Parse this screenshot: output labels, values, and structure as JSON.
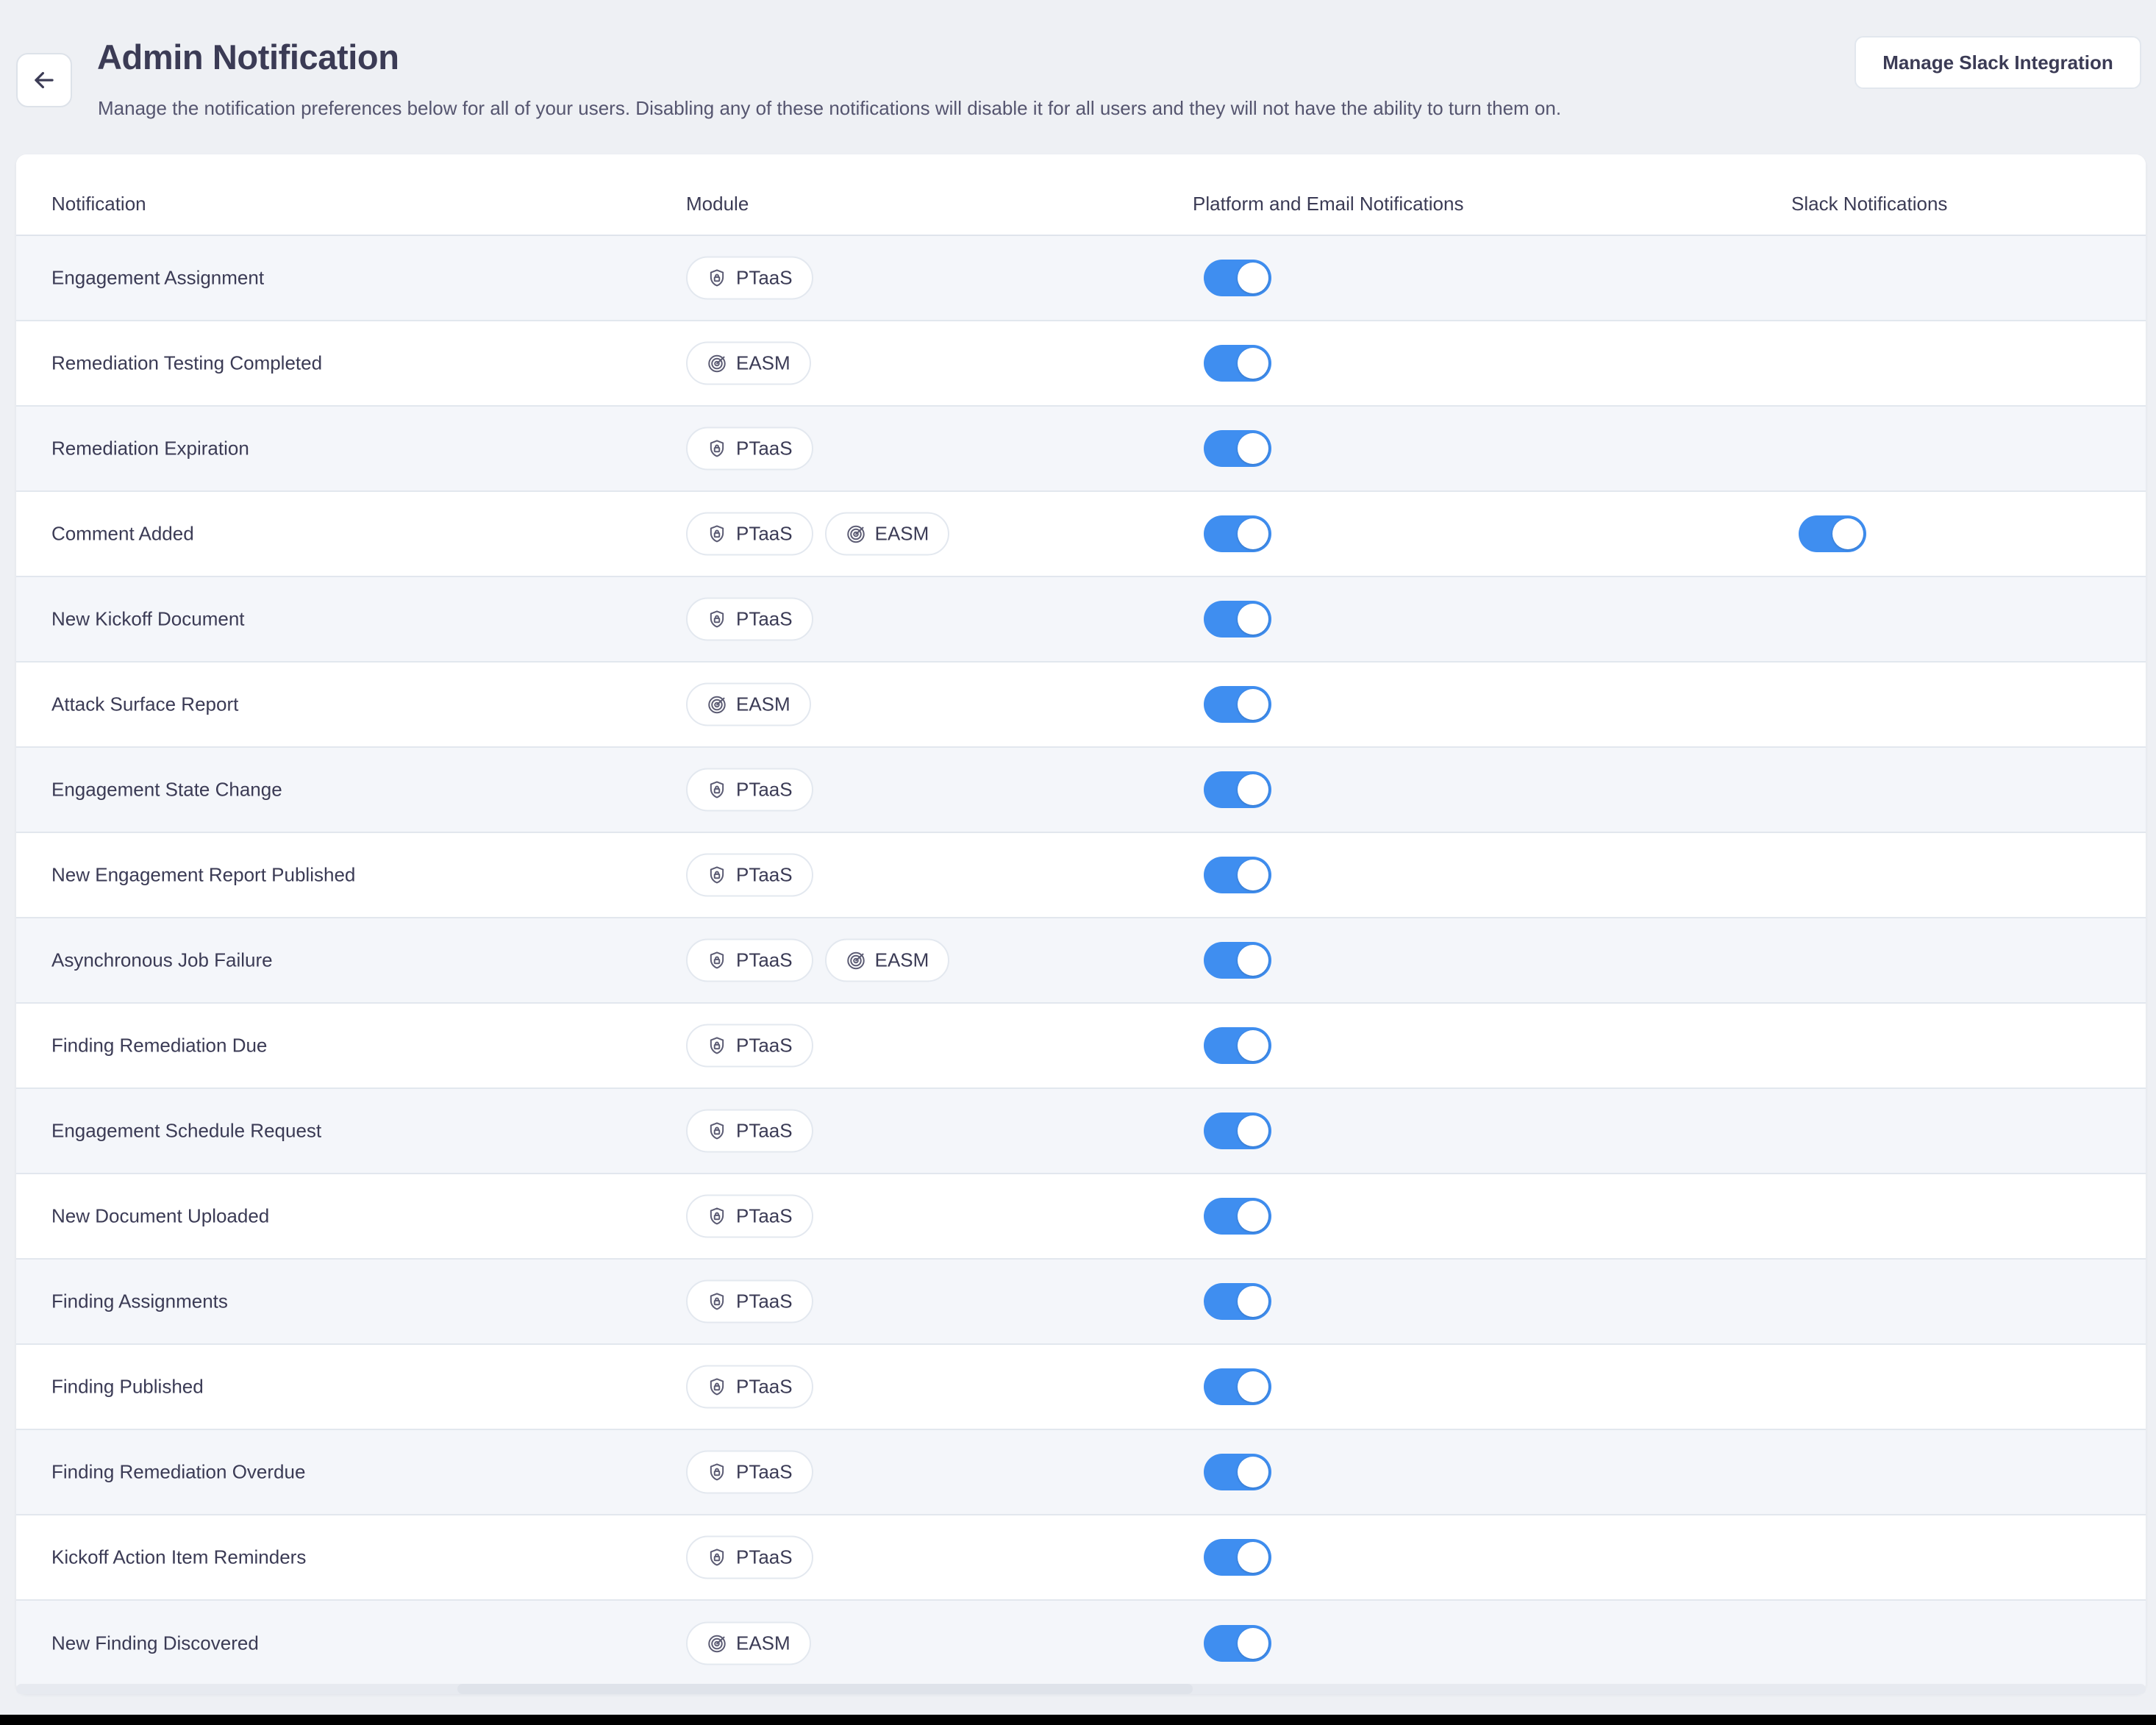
{
  "header": {
    "back_icon": "arrow-left-icon",
    "title": "Admin Notification",
    "subtitle": "Manage the notification preferences below for all of your users. Disabling any of these notifications will disable it for all users and they will not have the ability to turn them on.",
    "manage_slack_label": "Manage Slack Integration"
  },
  "table": {
    "columns": {
      "notification": "Notification",
      "module": "Module",
      "platform": "Platform and Email Notifications",
      "slack": "Slack Notifications"
    },
    "modules": {
      "ptaas": {
        "label": "PTaaS",
        "icon": "shield-lock-icon"
      },
      "easm": {
        "label": "EASM",
        "icon": "radar-target-icon"
      }
    },
    "rows": [
      {
        "notification": "Engagement Assignment",
        "modules": [
          "PTaaS"
        ],
        "platform_on": true,
        "slack_on": null
      },
      {
        "notification": "Remediation Testing Completed",
        "modules": [
          "EASM"
        ],
        "platform_on": true,
        "slack_on": null
      },
      {
        "notification": "Remediation Expiration",
        "modules": [
          "PTaaS"
        ],
        "platform_on": true,
        "slack_on": null
      },
      {
        "notification": "Comment Added",
        "modules": [
          "PTaaS",
          "EASM"
        ],
        "platform_on": true,
        "slack_on": true
      },
      {
        "notification": "New Kickoff Document",
        "modules": [
          "PTaaS"
        ],
        "platform_on": true,
        "slack_on": null
      },
      {
        "notification": "Attack Surface Report",
        "modules": [
          "EASM"
        ],
        "platform_on": true,
        "slack_on": null
      },
      {
        "notification": "Engagement State Change",
        "modules": [
          "PTaaS"
        ],
        "platform_on": true,
        "slack_on": null
      },
      {
        "notification": "New Engagement Report Published",
        "modules": [
          "PTaaS"
        ],
        "platform_on": true,
        "slack_on": null
      },
      {
        "notification": "Asynchronous Job Failure",
        "modules": [
          "PTaaS",
          "EASM"
        ],
        "platform_on": true,
        "slack_on": null
      },
      {
        "notification": "Finding Remediation Due",
        "modules": [
          "PTaaS"
        ],
        "platform_on": true,
        "slack_on": null
      },
      {
        "notification": "Engagement Schedule Request",
        "modules": [
          "PTaaS"
        ],
        "platform_on": true,
        "slack_on": null
      },
      {
        "notification": "New Document Uploaded",
        "modules": [
          "PTaaS"
        ],
        "platform_on": true,
        "slack_on": null
      },
      {
        "notification": "Finding Assignments",
        "modules": [
          "PTaaS"
        ],
        "platform_on": true,
        "slack_on": null
      },
      {
        "notification": "Finding Published",
        "modules": [
          "PTaaS"
        ],
        "platform_on": true,
        "slack_on": null
      },
      {
        "notification": "Finding Remediation Overdue",
        "modules": [
          "PTaaS"
        ],
        "platform_on": true,
        "slack_on": null
      },
      {
        "notification": "Kickoff Action Item Reminders",
        "modules": [
          "PTaaS"
        ],
        "platform_on": true,
        "slack_on": null
      },
      {
        "notification": "New Finding Discovered",
        "modules": [
          "EASM"
        ],
        "platform_on": true,
        "slack_on": null
      }
    ]
  },
  "colors": {
    "page_background": "#eef0f4",
    "card_background": "#ffffff",
    "row_alt_background": "#f4f6fa",
    "toggle_on": "#3f8ef0",
    "text_primary": "#3b3b55",
    "border": "#e2e7ee"
  }
}
